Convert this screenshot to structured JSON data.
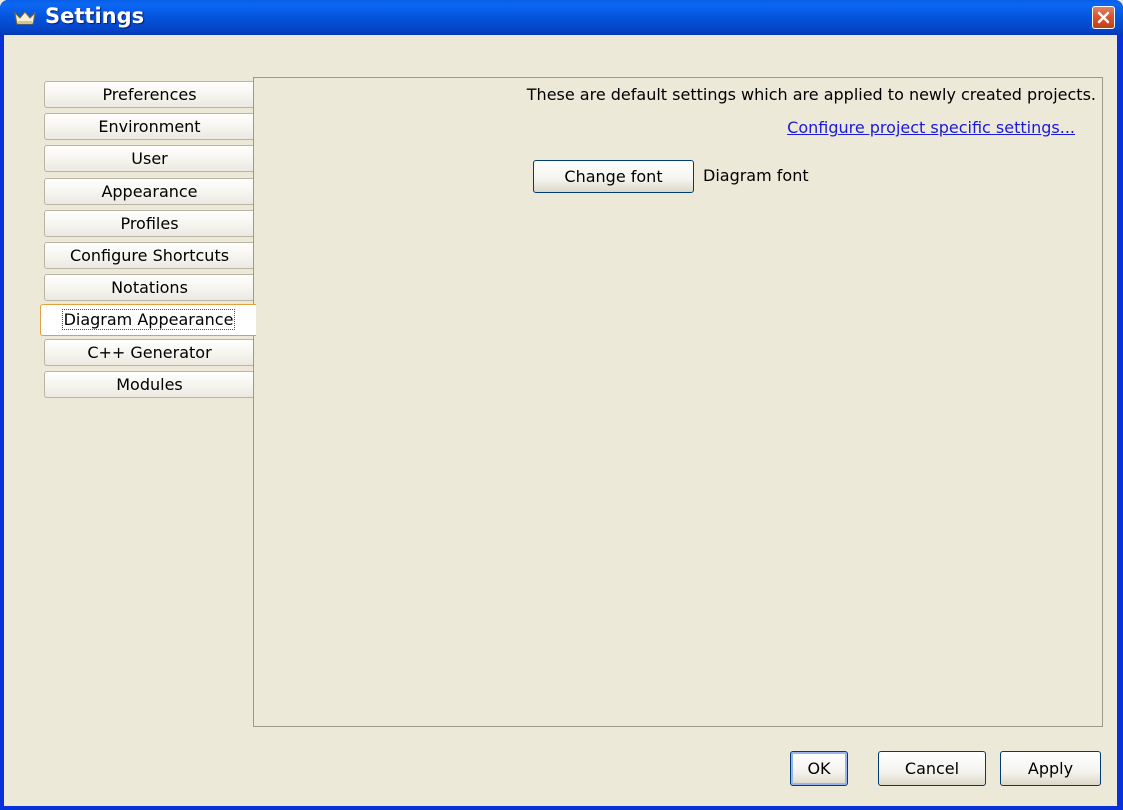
{
  "window": {
    "title": "Settings",
    "app_icon": "crown-icon",
    "close_icon": "close-icon"
  },
  "tabs": [
    {
      "label": "Preferences",
      "active": false
    },
    {
      "label": "Environment",
      "active": false
    },
    {
      "label": "User",
      "active": false
    },
    {
      "label": "Appearance",
      "active": false
    },
    {
      "label": "Profiles",
      "active": false
    },
    {
      "label": "Configure Shortcuts",
      "active": false
    },
    {
      "label": "Notations",
      "active": false
    },
    {
      "label": "Diagram Appearance",
      "active": true
    },
    {
      "label": "C++ Generator",
      "active": false
    },
    {
      "label": "Modules",
      "active": false
    }
  ],
  "panel": {
    "info_text": "These are default settings which are applied to newly created projects.",
    "config_link": "Configure project specific settings...",
    "change_font_label": "Change font",
    "font_label": "Diagram font"
  },
  "buttons": {
    "ok": "OK",
    "cancel": "Cancel",
    "apply": "Apply"
  },
  "colors": {
    "titlebar": "#0553dc",
    "face": "#ece9d8",
    "link": "#1a1ad8",
    "active_tab_border": "#e0a23c"
  }
}
